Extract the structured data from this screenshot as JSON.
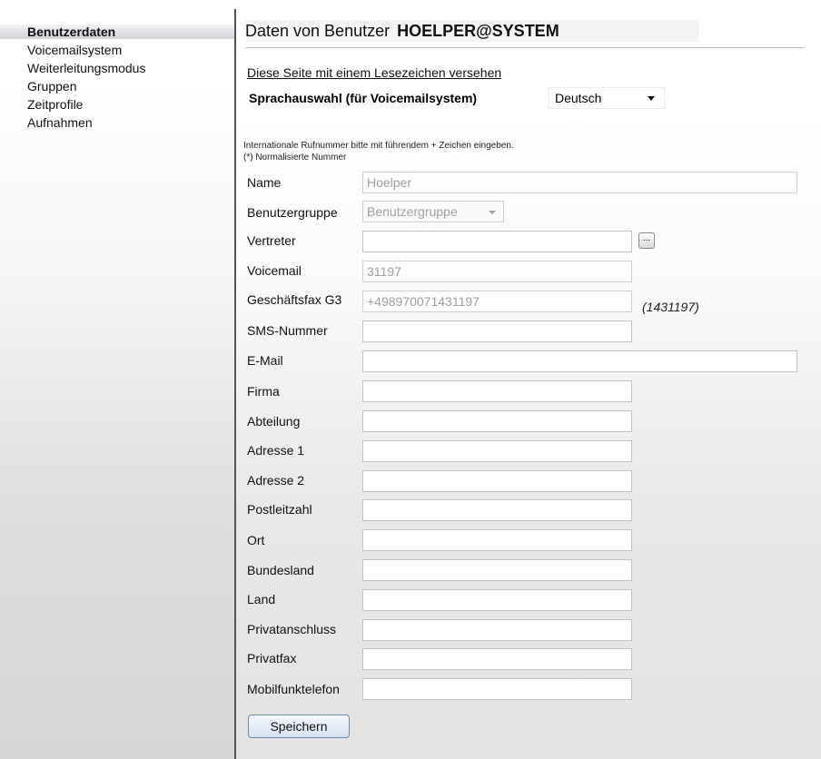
{
  "sidebar": {
    "items": [
      {
        "label": "Benutzerdaten",
        "active": true
      },
      {
        "label": "Voicemailsystem",
        "active": false
      },
      {
        "label": "Weiterleitungsmodus",
        "active": false
      },
      {
        "label": "Gruppen",
        "active": false
      },
      {
        "label": "Zeitprofile",
        "active": false
      },
      {
        "label": "Aufnahmen",
        "active": false
      }
    ]
  },
  "header": {
    "title": "Daten von Benutzer",
    "user": "HOELPER@SYSTEM"
  },
  "bookmark_link": "Diese Seite mit einem Lesezeichen versehen",
  "language": {
    "label": "Sprachauswahl (für Voicemailsystem)",
    "selected": "Deutsch"
  },
  "hints": {
    "line1": "Internationale Rufnummer bitte mit führendem + Zeichen eingeben.",
    "line2": "(*) Normalisierte Nummer"
  },
  "fields": {
    "name": {
      "label": "Name",
      "value": "Hoelper"
    },
    "group": {
      "label": "Benutzergruppe",
      "value": "Benutzergruppe"
    },
    "deputy": {
      "label": "Vertreter",
      "value": "",
      "button": "..."
    },
    "voicemail": {
      "label": "Voicemail",
      "value": "31197"
    },
    "fax": {
      "label": "Geschäftsfax G3",
      "value": "+498970071431197",
      "normalized": "(1431197)"
    },
    "sms": {
      "label": "SMS-Nummer",
      "value": ""
    },
    "email": {
      "label": "E-Mail",
      "value": ""
    },
    "company": {
      "label": "Firma",
      "value": ""
    },
    "department": {
      "label": "Abteilung",
      "value": ""
    },
    "address1": {
      "label": "Adresse 1",
      "value": ""
    },
    "address2": {
      "label": "Adresse 2",
      "value": ""
    },
    "zip": {
      "label": "Postleitzahl",
      "value": ""
    },
    "city": {
      "label": "Ort",
      "value": ""
    },
    "state": {
      "label": "Bundesland",
      "value": ""
    },
    "country": {
      "label": "Land",
      "value": ""
    },
    "private_phone": {
      "label": "Privatanschluss",
      "value": ""
    },
    "private_fax": {
      "label": "Privatfax",
      "value": ""
    },
    "mobile": {
      "label": "Mobilfunktelefon",
      "value": ""
    }
  },
  "save_label": "Speichern"
}
